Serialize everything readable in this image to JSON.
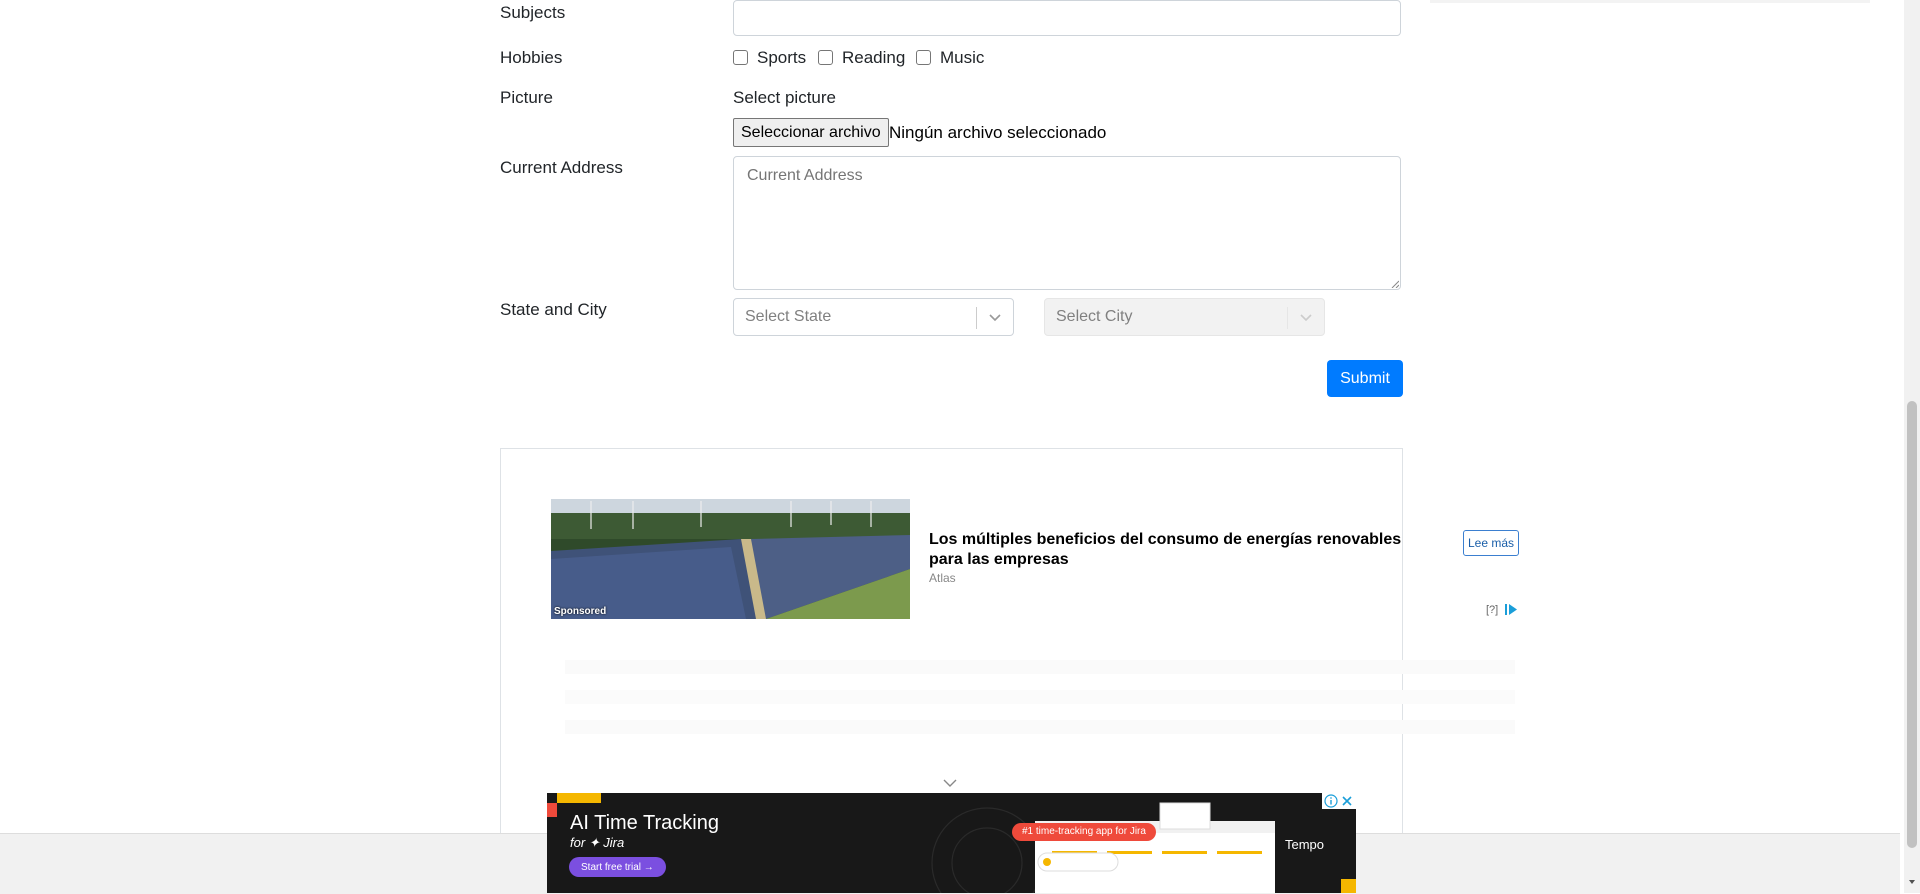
{
  "form": {
    "subjects_label": "Subjects",
    "hobbies_label": "Hobbies",
    "hobbies": [
      {
        "label": "Sports",
        "checked": false
      },
      {
        "label": "Reading",
        "checked": false
      },
      {
        "label": "Music",
        "checked": false
      }
    ],
    "picture_label": "Picture",
    "picture_hint": "Select picture",
    "file_button": "Seleccionar archivo",
    "file_status": "Ningún archivo seleccionado",
    "address_label": "Current Address",
    "address_placeholder": "Current Address",
    "state_city_label": "State and City",
    "state_placeholder": "Select State",
    "city_placeholder": "Select City",
    "submit_label": "Submit"
  },
  "ad": {
    "badge": "Sponsored",
    "title": "Los múltiples beneficios del consumo de energías renovables para las empresas",
    "source": "Atlas",
    "cta": "Lee más",
    "help": "[?]"
  },
  "bottom_ad": {
    "title": "AI Time Tracking",
    "subtitle": "for ✦ Jira",
    "button": "Start free trial →",
    "pill": "#1 time-tracking app for Jira",
    "brand": "Tempo"
  },
  "colors": {
    "accent": "#007bff",
    "ad_dark": "#181818",
    "brand_yellow": "#f5b700",
    "brand_red": "#ef4a3b",
    "brand_purple": "#7b4fe0"
  }
}
